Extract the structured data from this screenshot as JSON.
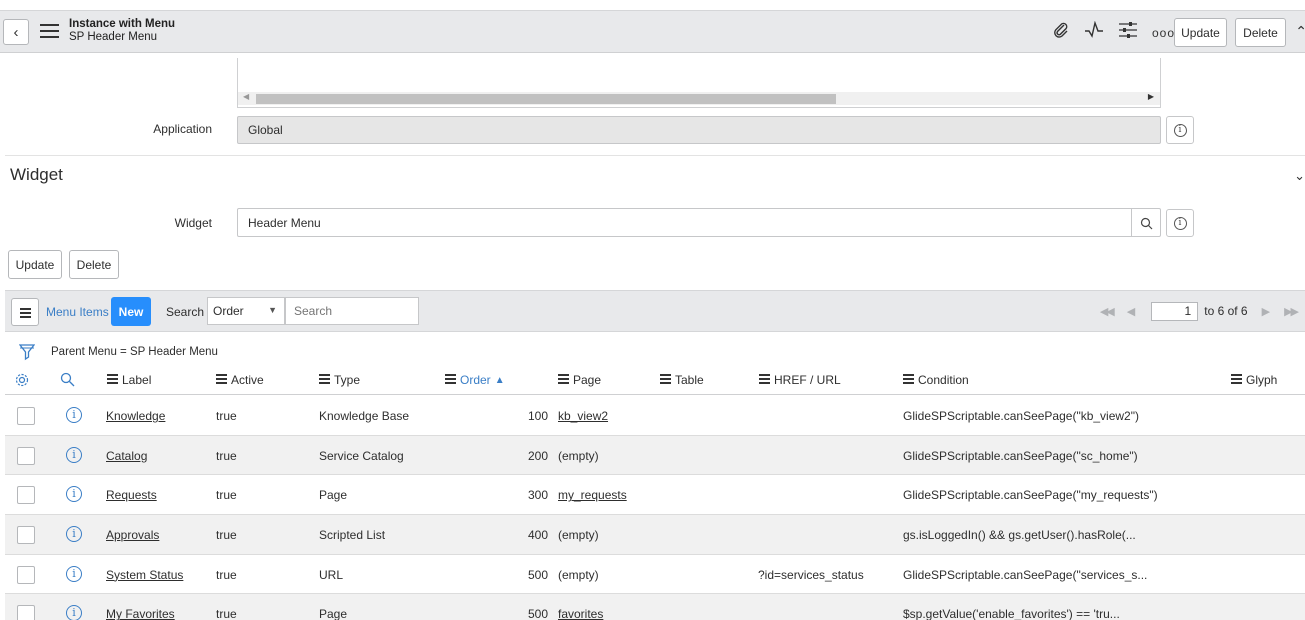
{
  "header": {
    "title": "Instance with Menu",
    "subtitle": "SP Header Menu",
    "update_label": "Update",
    "delete_label": "Delete",
    "icons": [
      "paperclip-icon",
      "activity-icon",
      "sliders-icon",
      "more-icon"
    ]
  },
  "form": {
    "application_label": "Application",
    "application_value": "Global",
    "section_title": "Widget",
    "widget_label": "Widget",
    "widget_value": "Header Menu",
    "update_label": "Update",
    "delete_label": "Delete"
  },
  "list": {
    "title": "Menu Items",
    "new_label": "New",
    "search_label": "Search",
    "search_field": "Order",
    "search_placeholder": "Search",
    "page_current": "1",
    "page_of": "to 6 of 6",
    "filter": "Parent Menu = SP Header Menu",
    "columns": {
      "label": "Label",
      "active": "Active",
      "type": "Type",
      "order": "Order",
      "page": "Page",
      "table": "Table",
      "href": "HREF / URL",
      "condition": "Condition",
      "glyph": "Glyph"
    },
    "rows": [
      {
        "label": "Knowledge",
        "active": "true",
        "type": "Knowledge Base",
        "order": "100",
        "page": "kb_view2",
        "page_link": true,
        "href": "",
        "condition": "GlideSPScriptable.canSeePage(\"kb_view2\")"
      },
      {
        "label": "Catalog",
        "active": "true",
        "type": "Service Catalog",
        "order": "200",
        "page": "(empty)",
        "page_link": false,
        "href": "",
        "condition": "GlideSPScriptable.canSeePage(\"sc_home\")"
      },
      {
        "label": "Requests",
        "active": "true",
        "type": "Page",
        "order": "300",
        "page": "my_requests",
        "page_link": true,
        "href": "",
        "condition": "GlideSPScriptable.canSeePage(\"my_requests\")"
      },
      {
        "label": "Approvals",
        "active": "true",
        "type": "Scripted List",
        "order": "400",
        "page": "(empty)",
        "page_link": false,
        "href": "",
        "condition": "gs.isLoggedIn() && gs.getUser().hasRole(..."
      },
      {
        "label": "System Status",
        "active": "true",
        "type": "URL",
        "order": "500",
        "page": "(empty)",
        "page_link": false,
        "href": "?id=services_status",
        "condition": "GlideSPScriptable.canSeePage(\"services_s..."
      },
      {
        "label": "My Favorites",
        "active": "true",
        "type": "Page",
        "order": "500",
        "page": "favorites",
        "page_link": true,
        "href": "",
        "condition": "$sp.getValue('enable_favorites') == 'tru..."
      }
    ]
  }
}
